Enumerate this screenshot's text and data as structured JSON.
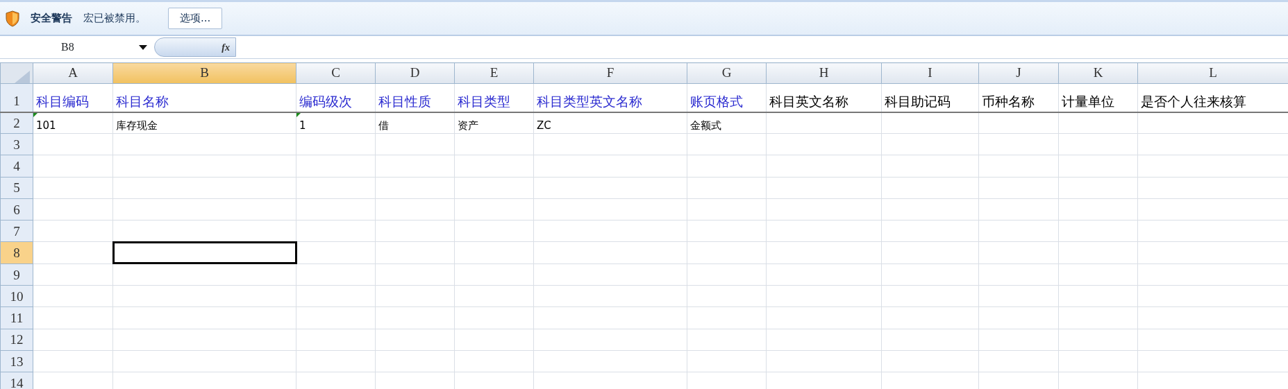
{
  "security_bar": {
    "title": "安全警告",
    "message": "宏已被禁用。",
    "button": "选项..."
  },
  "formula_bar": {
    "name_box": "B8",
    "function_label": "fx"
  },
  "columns": [
    {
      "label": "A",
      "selected": false
    },
    {
      "label": "B",
      "selected": true
    },
    {
      "label": "C",
      "selected": false
    },
    {
      "label": "D",
      "selected": false
    },
    {
      "label": "E",
      "selected": false
    },
    {
      "label": "F",
      "selected": false
    },
    {
      "label": "G",
      "selected": false
    },
    {
      "label": "H",
      "selected": false
    },
    {
      "label": "I",
      "selected": false
    },
    {
      "label": "J",
      "selected": false
    },
    {
      "label": "K",
      "selected": false
    },
    {
      "label": "L",
      "selected": false
    }
  ],
  "rows": [
    {
      "label": "1",
      "selected": false,
      "kind": "heading",
      "cells": [
        {
          "text": "科目编码",
          "color": "#2b2bd0",
          "selected": false
        },
        {
          "text": "科目名称",
          "color": "#2b2bd0",
          "selected": false
        },
        {
          "text": "编码级次",
          "color": "#2b2bd0",
          "selected": false
        },
        {
          "text": "科目性质",
          "color": "#2b2bd0",
          "selected": false
        },
        {
          "text": "科目类型",
          "color": "#2b2bd0",
          "selected": false
        },
        {
          "text": "科目类型英文名称",
          "color": "#2b2bd0",
          "selected": false
        },
        {
          "text": "账页格式",
          "color": "#2b2bd0",
          "selected": false
        },
        {
          "text": "科目英文名称",
          "color": "#000000",
          "selected": false
        },
        {
          "text": "科目助记码",
          "color": "#000000",
          "selected": false
        },
        {
          "text": "币种名称",
          "color": "#000000",
          "selected": false
        },
        {
          "text": "计量单位",
          "color": "#000000",
          "selected": false
        },
        {
          "text": "是否个人往来核算",
          "color": "#000000",
          "selected": false
        }
      ]
    },
    {
      "label": "2",
      "selected": false,
      "kind": "data",
      "cells": [
        {
          "text": "101",
          "flagged": true,
          "selected": false
        },
        {
          "text": "库存现金",
          "flagged": false,
          "selected": false
        },
        {
          "text": "1",
          "flagged": true,
          "selected": false
        },
        {
          "text": "借",
          "flagged": false,
          "selected": false
        },
        {
          "text": "资产",
          "flagged": false,
          "selected": false
        },
        {
          "text": "ZC",
          "flagged": false,
          "selected": false
        },
        {
          "text": "金额式",
          "flagged": false,
          "selected": false
        }
      ]
    },
    {
      "label": "3",
      "selected": false
    },
    {
      "label": "4",
      "selected": false
    },
    {
      "label": "5",
      "selected": false
    },
    {
      "label": "6",
      "selected": false
    },
    {
      "label": "7",
      "selected": false
    },
    {
      "label": "8",
      "selected": true,
      "cells": [
        {
          "selected": false
        },
        {
          "selected": true
        }
      ]
    },
    {
      "label": "9",
      "selected": false
    },
    {
      "label": "10",
      "selected": false
    },
    {
      "label": "11",
      "selected": false
    },
    {
      "label": "12",
      "selected": false
    },
    {
      "label": "13",
      "selected": false
    },
    {
      "label": "14",
      "selected": false
    }
  ]
}
